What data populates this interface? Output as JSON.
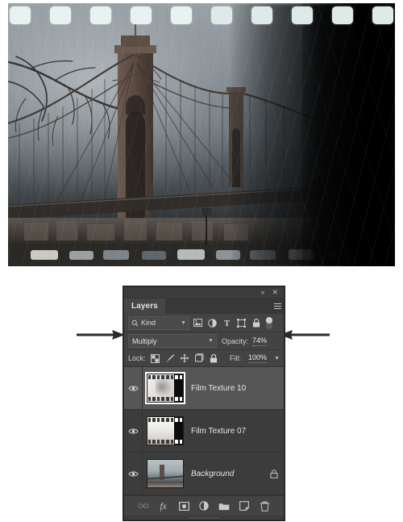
{
  "document": {
    "canvas_description": "Brooklyn Bridge photograph with film texture overlay",
    "photo_subject": "brooklyn-bridge"
  },
  "panel": {
    "tab_label": "Layers",
    "collapse_icon": "«",
    "close_icon": "✕",
    "menu_icon": "panel-menu-icon",
    "filter": {
      "kind_label": "Kind",
      "search_icon": "search-icon",
      "icons": [
        {
          "name": "filter-pixel-layers-icon",
          "glyph": "image"
        },
        {
          "name": "filter-adjustment-layers-icon",
          "glyph": "halfcircle"
        },
        {
          "name": "filter-type-layers-icon",
          "glyph": "T"
        },
        {
          "name": "filter-shape-layers-icon",
          "glyph": "shape"
        },
        {
          "name": "filter-smart-objects-icon",
          "glyph": "lock"
        }
      ],
      "toggle_name": "filter-enable-toggle"
    },
    "blend": {
      "mode": "Multiply",
      "opacity_label": "Opacity:",
      "opacity_value": "74%"
    },
    "lock": {
      "label": "Lock:",
      "icons": [
        {
          "name": "lock-transparent-pixels-icon",
          "glyph": "checker"
        },
        {
          "name": "lock-image-pixels-icon",
          "glyph": "brush"
        },
        {
          "name": "lock-position-icon",
          "glyph": "move"
        },
        {
          "name": "lock-artboard-nesting-icon",
          "glyph": "artboard"
        },
        {
          "name": "lock-all-icon",
          "glyph": "padlock"
        }
      ],
      "fill_label": "Fill:",
      "fill_value": "100%"
    },
    "layers": [
      {
        "name": "Film Texture 10",
        "visible": true,
        "selected": true,
        "locked": false,
        "italic": false,
        "thumb": "filmstrip-grainy"
      },
      {
        "name": "Film Texture 07",
        "visible": true,
        "selected": false,
        "locked": false,
        "italic": false,
        "thumb": "filmstrip-light"
      },
      {
        "name": "Background",
        "visible": true,
        "selected": false,
        "locked": true,
        "italic": true,
        "thumb": "bridge-photo"
      }
    ],
    "bottom_buttons": [
      {
        "name": "link-layers-button",
        "glyph": "link",
        "disabled": true
      },
      {
        "name": "layer-style-fx-button",
        "glyph": "fx",
        "disabled": false
      },
      {
        "name": "add-layer-mask-button",
        "glyph": "mask",
        "disabled": false
      },
      {
        "name": "new-adjustment-layer-button",
        "glyph": "adjustment",
        "disabled": false
      },
      {
        "name": "new-group-button",
        "glyph": "folder",
        "disabled": false
      },
      {
        "name": "new-layer-button",
        "glyph": "newlayer",
        "disabled": false
      },
      {
        "name": "delete-layer-button",
        "glyph": "trash",
        "disabled": false
      }
    ]
  },
  "annotations": {
    "left_arrow_target": "Multiply",
    "right_arrow_target": "74%"
  },
  "colors": {
    "panel_bg": "#3c3c3c",
    "panel_control_bg": "#434343",
    "selected_layer_bg": "#565656",
    "text": "#e6e6e6",
    "arrow": "#2b2b2b"
  }
}
